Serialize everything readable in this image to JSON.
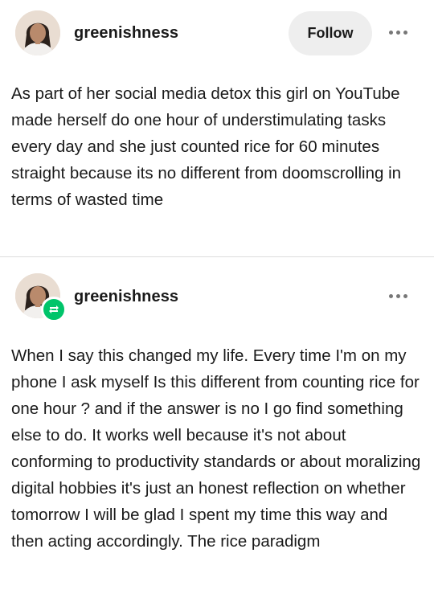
{
  "post1": {
    "username": "greenishness",
    "follow_label": "Follow",
    "more_icon": "more-horizontal-icon",
    "text": "As part of her social media detox this girl on YouTube made herself do one hour of understimulating tasks every day and she just counted rice for 60 minutes straight because its no different from doomscrolling in terms of wasted time"
  },
  "post2": {
    "username": "greenishness",
    "badge_icon": "reblog-icon",
    "badge_color": "#00c46a",
    "more_icon": "more-horizontal-icon",
    "text": "When I say this changed my life. Every time I'm on my phone I ask myself Is this different from counting rice for one hour ? and if the answer is no I go find something else to do. It works well because it's not about conforming to productivity standards or about moralizing digital hobbies it's just an honest reflection on whether tomorrow I will be glad I spent my time this way and then acting accordingly. The rice paradigm"
  }
}
